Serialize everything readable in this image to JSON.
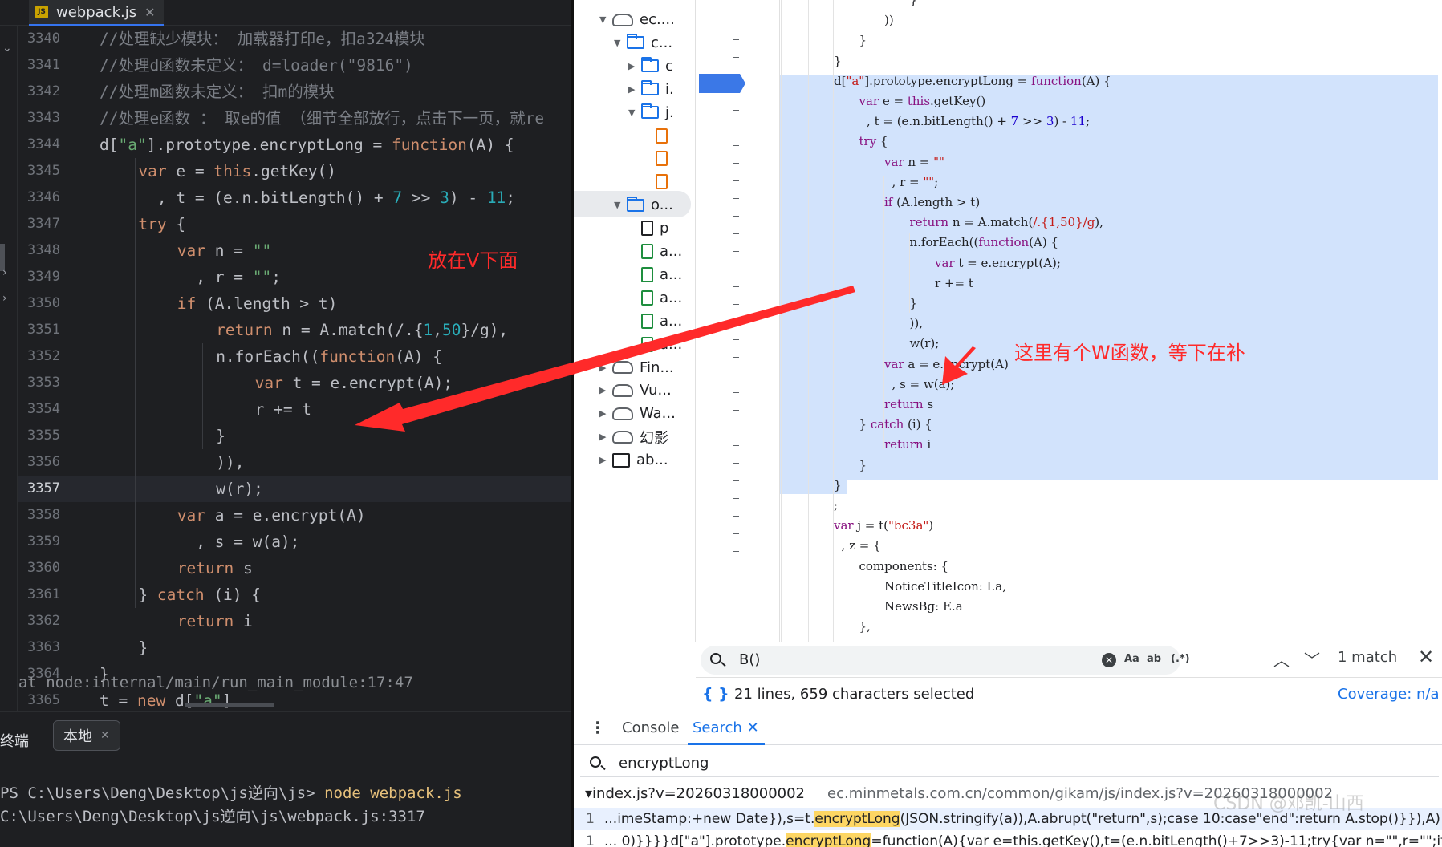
{
  "editor": {
    "tab_label": "webpack.js",
    "tab_badge": "JS",
    "lines": [
      {
        "n": "3340",
        "indent": 0,
        "tokens": [
          [
            "c-cm",
            "//处理缺少模块： 加载器打印e，扣a324模块"
          ]
        ]
      },
      {
        "n": "3341",
        "indent": 0,
        "tokens": [
          [
            "c-cm",
            "//处理d函数未定义： d=loader(\"9816\")"
          ]
        ]
      },
      {
        "n": "3342",
        "indent": 0,
        "tokens": [
          [
            "c-cm",
            "//处理m函数未定义： 扣m的模块"
          ]
        ]
      },
      {
        "n": "3343",
        "indent": 0,
        "tokens": [
          [
            "c-cm",
            "//处理e函数 ： 取e的值 （细节全部放行，点击下一页，就re"
          ]
        ]
      },
      {
        "n": "3344",
        "indent": 0,
        "tokens": [
          [
            "",
            "d["
          ],
          [
            "c-str",
            "\"a\""
          ],
          [
            "",
            "].prototype.encryptLong = "
          ],
          [
            "c-kw",
            "function"
          ],
          [
            "",
            "(A) {"
          ]
        ]
      },
      {
        "n": "3345",
        "indent": 1,
        "tokens": [
          [
            "c-kw",
            "var"
          ],
          [
            "",
            " e = "
          ],
          [
            "c-kw",
            "this"
          ],
          [
            "",
            ".getKey()"
          ]
        ]
      },
      {
        "n": "3346",
        "indent": 1,
        "tokens": [
          [
            "",
            "  , t = (e.n.bitLength() + "
          ],
          [
            "c-num",
            "7"
          ],
          [
            "",
            " >> "
          ],
          [
            "c-num",
            "3"
          ],
          [
            "",
            ") - "
          ],
          [
            "c-num",
            "11"
          ],
          [
            "",
            ";"
          ]
        ]
      },
      {
        "n": "3347",
        "indent": 1,
        "tokens": [
          [
            "c-kw",
            "try"
          ],
          [
            "",
            " {"
          ]
        ]
      },
      {
        "n": "3348",
        "indent": 2,
        "tokens": [
          [
            "c-kw",
            "var"
          ],
          [
            "",
            " n = "
          ],
          [
            "c-str",
            "\"\""
          ]
        ]
      },
      {
        "n": "3349",
        "indent": 2,
        "tokens": [
          [
            "",
            "  , r = "
          ],
          [
            "c-str",
            "\"\""
          ],
          [
            "",
            ";"
          ]
        ]
      },
      {
        "n": "3350",
        "indent": 2,
        "tokens": [
          [
            "c-kw",
            "if"
          ],
          [
            "",
            " (A.length > t)"
          ]
        ]
      },
      {
        "n": "3351",
        "indent": 3,
        "tokens": [
          [
            "c-kw",
            "return"
          ],
          [
            "",
            " n = A.match(/.{"
          ],
          [
            "c-num",
            "1"
          ],
          [
            "",
            ","
          ],
          [
            "c-num",
            "50"
          ],
          [
            "",
            "}/g),"
          ]
        ]
      },
      {
        "n": "3352",
        "indent": 3,
        "tokens": [
          [
            "",
            "n.forEach(("
          ],
          [
            "c-kw",
            "function"
          ],
          [
            "",
            "(A) {"
          ]
        ]
      },
      {
        "n": "3353",
        "indent": 4,
        "tokens": [
          [
            "c-kw",
            "var"
          ],
          [
            "",
            " t = e.encrypt(A);"
          ]
        ]
      },
      {
        "n": "3354",
        "indent": 4,
        "tokens": [
          [
            "",
            "r += t"
          ]
        ]
      },
      {
        "n": "3355",
        "indent": 3,
        "tokens": [
          [
            "",
            "}"
          ]
        ]
      },
      {
        "n": "3356",
        "indent": 3,
        "tokens": [
          [
            "",
            ")),"
          ]
        ]
      },
      {
        "n": "3357",
        "indent": 3,
        "tokens": [
          [
            "",
            "w(r);"
          ]
        ],
        "current": true
      },
      {
        "n": "3358",
        "indent": 2,
        "tokens": [
          [
            "c-kw",
            "var"
          ],
          [
            "",
            " a = e.encrypt(A)"
          ]
        ]
      },
      {
        "n": "3359",
        "indent": 2,
        "tokens": [
          [
            "",
            "  , s = w(a);"
          ]
        ]
      },
      {
        "n": "3360",
        "indent": 2,
        "tokens": [
          [
            "c-kw",
            "return"
          ],
          [
            "",
            " s"
          ]
        ]
      },
      {
        "n": "3361",
        "indent": 1,
        "tokens": [
          [
            "",
            "} "
          ],
          [
            "c-kw",
            "catch"
          ],
          [
            "",
            " (i) {"
          ]
        ]
      },
      {
        "n": "3362",
        "indent": 2,
        "tokens": [
          [
            "c-kw",
            "return"
          ],
          [
            "",
            " i"
          ]
        ]
      },
      {
        "n": "3363",
        "indent": 1,
        "tokens": [
          [
            "",
            "}"
          ]
        ]
      },
      {
        "n": "3364",
        "indent": 0,
        "tokens": [
          [
            "",
            "}"
          ]
        ]
      },
      {
        "n": "3365",
        "indent": 0,
        "tokens": [
          [
            "",
            "t = "
          ],
          [
            "c-kw",
            "new"
          ],
          [
            "",
            " d["
          ],
          [
            "c-str",
            "\"a\""
          ],
          [
            "",
            "]"
          ]
        ]
      }
    ]
  },
  "terminal": {
    "label": "终端",
    "tab_label": "本地",
    "lines": [
      {
        "text": "  at node:internal/main/run_main_module:17:47",
        "cmd": ""
      },
      {
        "text": "PS C:\\Users\\Deng\\Desktop\\js逆向\\js> ",
        "cmd": "node webpack.js"
      },
      {
        "text": "C:\\Users\\Deng\\Desktop\\js逆向\\js\\webpack.js:3317",
        "cmd": ""
      }
    ]
  },
  "tree": {
    "items": [
      {
        "label": "ec....",
        "icon": "cloud",
        "tri": "▼",
        "depth": 0
      },
      {
        "label": "c...",
        "icon": "folder",
        "tri": "▼",
        "depth": 1
      },
      {
        "label": "c",
        "icon": "folder",
        "tri": "▶",
        "depth": 2
      },
      {
        "label": "i.",
        "icon": "folder",
        "tri": "▶",
        "depth": 2
      },
      {
        "label": "j.",
        "icon": "folder",
        "tri": "▼",
        "depth": 2
      },
      {
        "label": "",
        "icon": "file",
        "tri": "",
        "depth": 3
      },
      {
        "label": "",
        "icon": "file",
        "tri": "",
        "depth": 3
      },
      {
        "label": "",
        "icon": "file",
        "tri": "",
        "depth": 3
      },
      {
        "label": "o...",
        "icon": "folder",
        "tri": "▼",
        "depth": 1
      },
      {
        "label": "p",
        "icon": "file-black",
        "tri": "",
        "depth": 2
      },
      {
        "label": "a...",
        "icon": "file-green",
        "tri": "",
        "depth": 2
      },
      {
        "label": "a...",
        "icon": "file-green",
        "tri": "",
        "depth": 2
      },
      {
        "label": "a...",
        "icon": "file-green",
        "tri": "",
        "depth": 2
      },
      {
        "label": "a...",
        "icon": "file-green",
        "tri": "",
        "depth": 2
      },
      {
        "label": "a...",
        "icon": "file-green",
        "tri": "",
        "depth": 2
      },
      {
        "label": "Fin...",
        "icon": "cloud",
        "tri": "▶",
        "depth": 0
      },
      {
        "label": "Vu...",
        "icon": "cloud",
        "tri": "▶",
        "depth": 0
      },
      {
        "label": "Wa...",
        "icon": "cloud",
        "tri": "▶",
        "depth": 0
      },
      {
        "label": "幻影",
        "icon": "cloud",
        "tri": "▶",
        "depth": 0
      },
      {
        "label": "ab...",
        "icon": "box",
        "tri": "▶",
        "depth": 0
      }
    ]
  },
  "devcode": {
    "lines": [
      {
        "indent": 5,
        "tokens": [
          [
            "",
            "}"
          ]
        ]
      },
      {
        "indent": 4,
        "tokens": [
          [
            "",
            "))"
          ]
        ]
      },
      {
        "indent": 3,
        "tokens": [
          [
            "",
            "}"
          ]
        ]
      },
      {
        "indent": 2,
        "tokens": [
          [
            "",
            "}"
          ]
        ]
      },
      {
        "indent": 2,
        "tokens": [
          [
            "",
            "d["
          ],
          [
            "d-str",
            "\"a\""
          ],
          [
            "",
            "].prototype.encryptLong = "
          ],
          [
            "d-kw",
            "function"
          ],
          [
            "",
            "(A) {"
          ]
        ]
      },
      {
        "indent": 3,
        "tokens": [
          [
            "d-kw",
            "var"
          ],
          [
            "",
            " e = "
          ],
          [
            "d-kw",
            "this"
          ],
          [
            "",
            ".getKey()"
          ]
        ]
      },
      {
        "indent": 3,
        "tokens": [
          [
            "",
            "  , t = (e.n.bitLength() + "
          ],
          [
            "d-num",
            "7"
          ],
          [
            "",
            " >> "
          ],
          [
            "d-num",
            "3"
          ],
          [
            "",
            ") - "
          ],
          [
            "d-num",
            "11"
          ],
          [
            "",
            ";"
          ]
        ]
      },
      {
        "indent": 3,
        "tokens": [
          [
            "d-kw",
            "try"
          ],
          [
            "",
            " {"
          ]
        ]
      },
      {
        "indent": 4,
        "tokens": [
          [
            "d-kw",
            "var"
          ],
          [
            "",
            " n = "
          ],
          [
            "d-str",
            "\"\""
          ]
        ]
      },
      {
        "indent": 4,
        "tokens": [
          [
            "",
            "  , r = "
          ],
          [
            "d-str",
            "\"\""
          ],
          [
            "",
            ";"
          ]
        ]
      },
      {
        "indent": 4,
        "tokens": [
          [
            "d-kw",
            "if"
          ],
          [
            "",
            " (A.length > t)"
          ]
        ]
      },
      {
        "indent": 5,
        "tokens": [
          [
            "d-kw",
            "return"
          ],
          [
            "",
            " n = A.match("
          ],
          [
            "d-re",
            "/.{1,50}/g"
          ],
          [
            "",
            "),"
          ]
        ]
      },
      {
        "indent": 5,
        "tokens": [
          [
            "",
            "n.forEach(("
          ],
          [
            "d-kw",
            "function"
          ],
          [
            "",
            "(A) {"
          ]
        ]
      },
      {
        "indent": 6,
        "tokens": [
          [
            "d-kw",
            "var"
          ],
          [
            "",
            " t = e.encrypt(A);"
          ]
        ]
      },
      {
        "indent": 6,
        "tokens": [
          [
            "",
            "r += t"
          ]
        ]
      },
      {
        "indent": 5,
        "tokens": [
          [
            "",
            "}"
          ]
        ]
      },
      {
        "indent": 5,
        "tokens": [
          [
            "",
            ")),"
          ]
        ]
      },
      {
        "indent": 5,
        "tokens": [
          [
            "",
            "w(r);"
          ]
        ]
      },
      {
        "indent": 4,
        "tokens": [
          [
            "d-kw",
            "var"
          ],
          [
            "",
            " a = e.encrypt(A)"
          ]
        ]
      },
      {
        "indent": 4,
        "tokens": [
          [
            "",
            "  , s = w(a);"
          ]
        ]
      },
      {
        "indent": 4,
        "tokens": [
          [
            "d-kw",
            "return"
          ],
          [
            "",
            " s"
          ]
        ]
      },
      {
        "indent": 3,
        "tokens": [
          [
            "",
            "} "
          ],
          [
            "d-kw",
            "catch"
          ],
          [
            "",
            " (i) {"
          ]
        ]
      },
      {
        "indent": 4,
        "tokens": [
          [
            "d-kw",
            "return"
          ],
          [
            "",
            " i"
          ]
        ]
      },
      {
        "indent": 3,
        "tokens": [
          [
            "",
            "}"
          ]
        ]
      },
      {
        "indent": 2,
        "tokens": [
          [
            "",
            "}"
          ]
        ]
      },
      {
        "indent": 2,
        "tokens": [
          [
            "",
            ";"
          ]
        ]
      },
      {
        "indent": 2,
        "tokens": [
          [
            "d-kw",
            "var"
          ],
          [
            "",
            " j = t("
          ],
          [
            "d-str",
            "\"bc3a\""
          ],
          [
            "",
            ")"
          ]
        ]
      },
      {
        "indent": 2,
        "tokens": [
          [
            "",
            "  , z = {"
          ]
        ]
      },
      {
        "indent": 3,
        "tokens": [
          [
            "",
            "components: {"
          ]
        ]
      },
      {
        "indent": 4,
        "tokens": [
          [
            "",
            "NoticeTitleIcon: I.a,"
          ]
        ]
      },
      {
        "indent": 4,
        "tokens": [
          [
            "",
            "NewsBg: E.a"
          ]
        ]
      },
      {
        "indent": 3,
        "tokens": [
          [
            "",
            "},"
          ]
        ]
      }
    ]
  },
  "search": {
    "value": "B()",
    "opt_case": "Aa",
    "opt_word": "ab",
    "opt_regex": "(.*)",
    "up": "︿",
    "down": "﹀",
    "count": "1 match",
    "close": "✕"
  },
  "status": {
    "braces": "{ }",
    "selection": "21 lines, 659 characters selected",
    "coverage": "Coverage: n/a"
  },
  "drawer": {
    "tabs": [
      "Console",
      "Search"
    ],
    "close": "✕",
    "query": "encryptLong",
    "file_name": "index.js?v=20260318000002",
    "file_url": "ec.minmetals.com.cn/common/gikam/js/index.js?v=20260318000002",
    "results": [
      {
        "n": "1",
        "pre": "...imeStamp:+new Date}),s=t.",
        "match": "encryptLong",
        "post": "(JSON.stringify(a)),A.abrupt(\"return\",s);case 10:case\"end\":return A.stop()}}),A)}))"
      },
      {
        "n": "1",
        "pre": "... 0)}}}}d[\"a\"].prototype.",
        "match": "encryptLong",
        "post": "=function(A){var e=this.getKey(),t=(e.n.bitLength()+7>>3)-11;try{var n=\"\",r=\"\";if(A.le"
      }
    ]
  },
  "watermark": "CSDN @邓凯-山西",
  "annotations": {
    "note1": "放在V下面",
    "note2": "这里有个W函数，等下在补",
    "color": "#ff2a2a"
  },
  "theme": {
    "editor_bg": "#1e1f22",
    "selection_blue": "#d2e3fc",
    "accent_blue": "#1a73e8"
  }
}
